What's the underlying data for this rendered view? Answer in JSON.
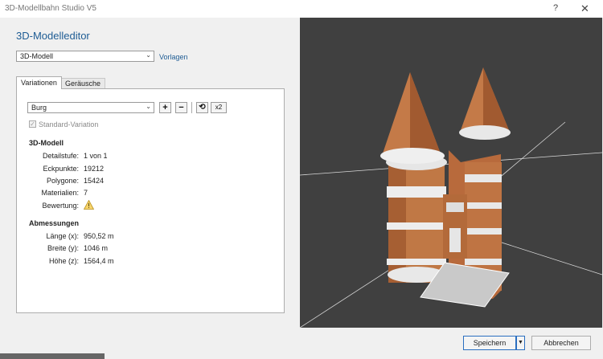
{
  "window": {
    "title": "3D-Modellbahn Studio V5",
    "help": "?",
    "close": "✕"
  },
  "editor": {
    "heading": "3D-Modelleditor",
    "model_select": "3D-Modell",
    "templates_link": "Vorlagen",
    "tabs": [
      "Variationen",
      "Geräusche"
    ],
    "variation_select": "Burg",
    "buttons": {
      "add": "+",
      "remove": "−",
      "refresh": "⟲",
      "double": "x2"
    },
    "standard_variation": {
      "label": "Standard-Variation",
      "checked": true
    }
  },
  "model": {
    "title": "3D-Modell",
    "rows": [
      {
        "label": "Detailstufe:",
        "value": "1 von 1"
      },
      {
        "label": "Eckpunkte:",
        "value": "19212"
      },
      {
        "label": "Polygone:",
        "value": "15424"
      },
      {
        "label": "Materialien:",
        "value": "7"
      },
      {
        "label": "Bewertung:",
        "value": ""
      }
    ],
    "rating_icon": "warning-icon"
  },
  "dimensions": {
    "title": "Abmessungen",
    "rows": [
      {
        "label": "Länge (x):",
        "value": "950,52 m"
      },
      {
        "label": "Breite (y):",
        "value": "1046 m"
      },
      {
        "label": "Höhe (z):",
        "value": "1564,4 m"
      }
    ]
  },
  "footer": {
    "save": "Speichern",
    "cancel": "Abbrechen"
  },
  "colors": {
    "accent": "#1e5c94",
    "viewport_bg": "#404040",
    "brick": "#b86a3c"
  }
}
